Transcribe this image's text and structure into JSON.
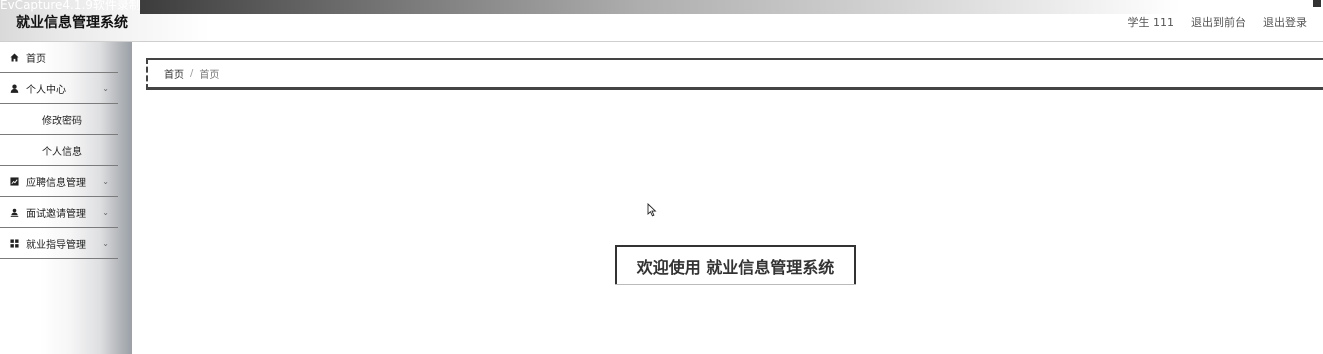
{
  "capture_overlay": "EvCapture4.1.9软件录制",
  "header": {
    "title": "就业信息管理系统",
    "links": [
      "学生 111",
      "退出到前台",
      "退出登录"
    ]
  },
  "sidebar": {
    "items": [
      {
        "label": "首页",
        "icon": "home-icon"
      },
      {
        "label": "个人中心",
        "icon": "user-icon",
        "expandable": true
      },
      {
        "label": "修改密码",
        "sub": true
      },
      {
        "label": "个人信息",
        "sub": true
      },
      {
        "label": "应聘信息管理",
        "icon": "chart-icon",
        "expandable": true
      },
      {
        "label": "面试邀请管理",
        "icon": "user-upload-icon",
        "expandable": true
      },
      {
        "label": "就业指导管理",
        "icon": "grid-icon",
        "expandable": true
      }
    ]
  },
  "breadcrumb": [
    "首页",
    "首页"
  ],
  "welcome": "欢迎使用 就业信息管理系统"
}
